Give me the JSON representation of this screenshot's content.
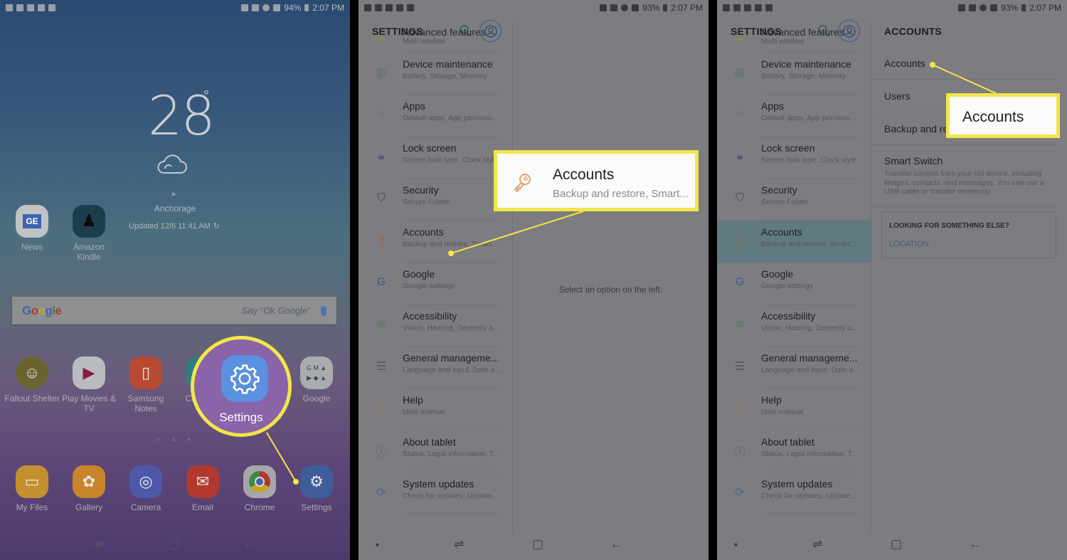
{
  "accent_color": "#f2e64a",
  "panel1": {
    "status": {
      "battery": "94%",
      "time": "2:07 PM"
    },
    "weather": {
      "temperature": "28",
      "degree_symbol": "°",
      "condition_icon": "cloud-icon",
      "city": "Anchorage",
      "updated": "Updated 12/6 11:41 AM"
    },
    "top_apps": [
      {
        "label": "News",
        "icon": "news-icon"
      },
      {
        "label": "Amazon Kindle",
        "icon": "kindle-icon"
      }
    ],
    "search": {
      "logo": "Google",
      "hint": "Say \"Ok Google\""
    },
    "apps_row": [
      {
        "label": "Fallout Shelter",
        "icon": "fallout-shelter-icon"
      },
      {
        "label": "Play Movies & TV",
        "icon": "play-movies-icon"
      },
      {
        "label": "Samsung Notes",
        "icon": "samsung-notes-icon"
      },
      {
        "label": "Calendar",
        "icon": "calendar-icon"
      },
      {
        "label": "Google",
        "icon": "google-folder-icon"
      }
    ],
    "dock": [
      {
        "label": "My Files",
        "icon": "folder-icon"
      },
      {
        "label": "Gallery",
        "icon": "gallery-icon"
      },
      {
        "label": "Camera",
        "icon": "camera-icon"
      },
      {
        "label": "Email",
        "icon": "email-icon"
      },
      {
        "label": "Chrome",
        "icon": "chrome-icon"
      },
      {
        "label": "Settings",
        "icon": "gear-icon"
      }
    ],
    "callout_label": "Settings"
  },
  "settings": {
    "status": {
      "battery": "93%",
      "time": "2:07 PM"
    },
    "title": "SETTINGS",
    "items": [
      {
        "title": "Advanced features",
        "subtitle": "Multi window",
        "icon": "advanced-features-icon"
      },
      {
        "title": "Device maintenance",
        "subtitle": "Battery, Storage, Memory",
        "icon": "device-maintenance-icon"
      },
      {
        "title": "Apps",
        "subtitle": "Default apps, App permissi...",
        "icon": "apps-icon"
      },
      {
        "title": "Lock screen",
        "subtitle": "Screen lock type, Clock style",
        "icon": "lock-icon"
      },
      {
        "title": "Security",
        "subtitle": "Secure Folder",
        "icon": "shield-icon"
      },
      {
        "title": "Accounts",
        "subtitle": "Backup and restore, Smart...",
        "icon": "key-icon"
      },
      {
        "title": "Google",
        "subtitle": "Google settings",
        "icon": "google-g-icon"
      },
      {
        "title": "Accessibility",
        "subtitle": "Vision, Hearing, Dexterity a...",
        "icon": "accessibility-icon"
      },
      {
        "title": "General manageme...",
        "subtitle": "Language and input, Date a...",
        "icon": "sliders-icon"
      },
      {
        "title": "Help",
        "subtitle": "User manual",
        "icon": "help-icon"
      },
      {
        "title": "About tablet",
        "subtitle": "Status, Legal information, T...",
        "icon": "info-icon"
      },
      {
        "title": "System updates",
        "subtitle": "Check for updates, Update...",
        "icon": "system-update-icon"
      }
    ],
    "empty_message": "Select an option on the left.",
    "callout": {
      "title": "Accounts",
      "subtitle": "Backup and restore, Smart..."
    }
  },
  "accounts": {
    "title": "ACCOUNTS",
    "items": [
      {
        "title": "Accounts",
        "subtitle": ""
      },
      {
        "title": "Users",
        "subtitle": ""
      },
      {
        "title": "Backup and restore",
        "subtitle": ""
      },
      {
        "title": "Smart Switch",
        "subtitle": "Transfer content from your old device, including images, contacts, and messages. You can use a USB cable or transfer wirelessly."
      }
    ],
    "looking": {
      "question": "LOOKING FOR SOMETHING ELSE?",
      "link": "LOCATION"
    },
    "callout_label": "Accounts"
  }
}
